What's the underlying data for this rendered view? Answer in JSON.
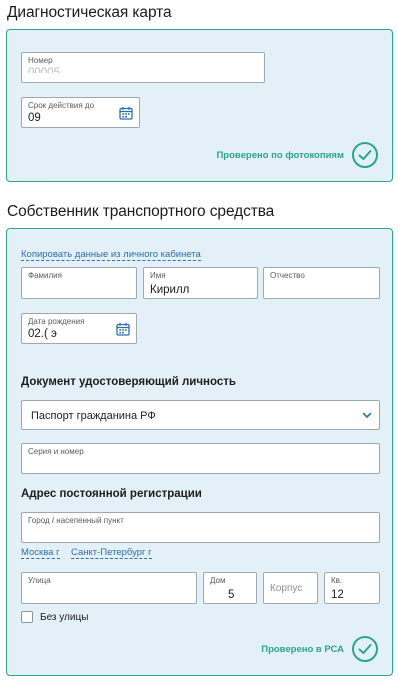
{
  "diag_card": {
    "title": "Диагностическая карта",
    "number_label": "Номер",
    "number_value": "00005",
    "expiry_label": "Срок действия до",
    "expiry_value": "09",
    "verified_text": "Проверено по фотокопиям"
  },
  "owner": {
    "title": "Собственник транспортного средства",
    "copy_link": "Копировать данные из личного кабинета",
    "surname_label": "Фамилия",
    "surname_value": "",
    "name_label": "Имя",
    "name_value": "Кирилл",
    "patronymic_label": "Отчество",
    "patronymic_value": "",
    "birthdate_label": "Дата рождения",
    "birthdate_value": "02.(                э",
    "id_doc_heading": "Документ удостоверяющий личность",
    "doc_type_value": "Паспорт гражданина РФ",
    "series_label": "Серия и номер",
    "series_value": "",
    "address_heading": "Адрес постоянной регистрации",
    "city_label": "Город / населенный пункт",
    "city_value": "",
    "city_quick": [
      "Москва г",
      "Санкт-Петербург г"
    ],
    "street_label": "Улица",
    "street_value": "",
    "house_label": "Дом",
    "house_value": "5",
    "korpus_placeholder": "Корпус",
    "apt_label": "Кв.",
    "apt_value": "12",
    "no_street_label": "Без улицы",
    "no_street_checked": false,
    "verified_text": "Проверено в РСА"
  },
  "colors": {
    "accent_green": "#2aa68c",
    "panel_bg": "#e3f0f7",
    "link_blue": "#2d6fb3"
  }
}
